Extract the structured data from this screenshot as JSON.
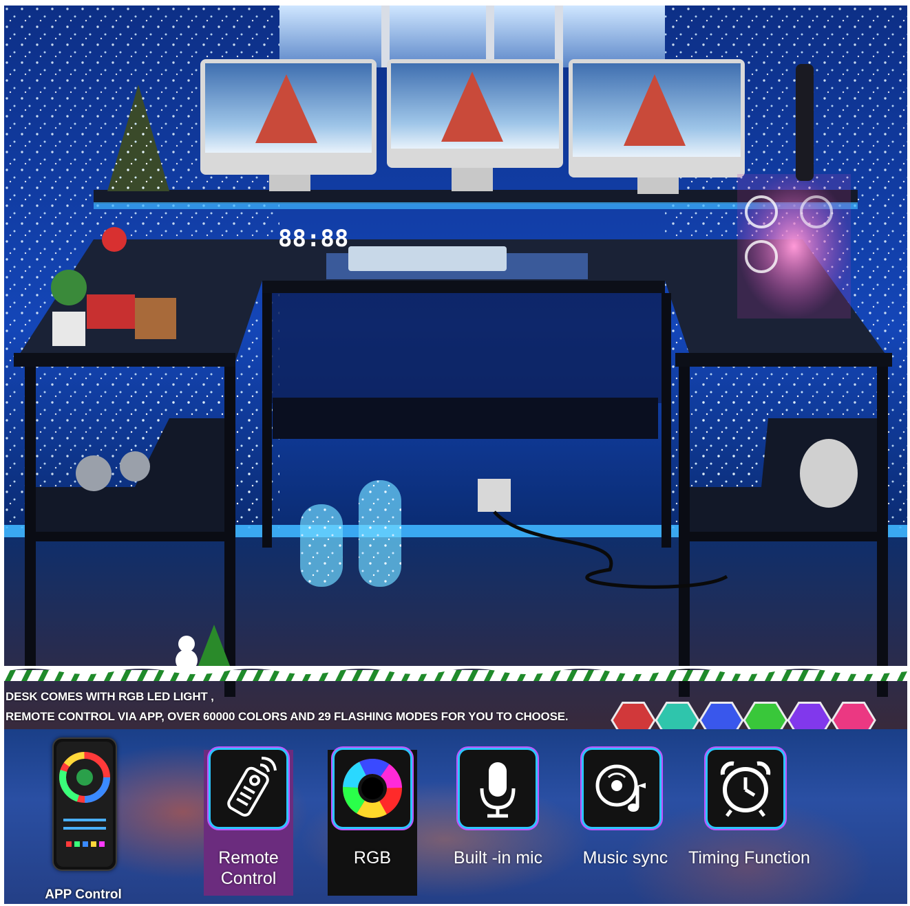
{
  "caption": {
    "line1": "DESK COMES WITH RGB LED LIGHT ,",
    "line2": "REMOTE CONTROL VIA APP, OVER 60000 COLORS AND 29 FLASHING MODES FOR YOU TO CHOOSE."
  },
  "features": [
    {
      "label": "APP Control",
      "icon": "phone-app-icon"
    },
    {
      "label": "Remote Control",
      "icon": "remote-control-icon"
    },
    {
      "label": "RGB",
      "icon": "color-wheel-icon"
    },
    {
      "label": "Built -in mic",
      "icon": "microphone-icon"
    },
    {
      "label": "Music sync",
      "icon": "music-note-icon"
    },
    {
      "label": "Timing Function",
      "icon": "alarm-clock-icon"
    }
  ],
  "labels": {
    "remote_line1": "Remote",
    "remote_line2": "Control"
  },
  "hex_colors": [
    "#e23a3a",
    "#2fd6b8",
    "#3a5cff",
    "#3ad83a",
    "#8a3aff",
    "#ff3a8a"
  ],
  "colors": {
    "scene_blue": "#0d3aa8",
    "led_glow": "#3fb6ff",
    "remote_tile": "#6b2c7e",
    "rgb_tile": "#111111"
  }
}
